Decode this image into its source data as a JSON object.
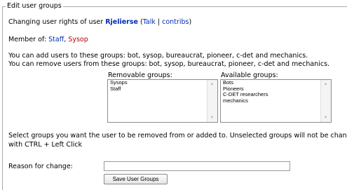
{
  "legend": "Edit user groups",
  "header": {
    "prefix": "Changing user rights of user ",
    "username": "Rjelierse",
    "open_paren": " (",
    "talk_link": "Talk",
    "separator": " | ",
    "contribs_link": "contribs",
    "close_paren": ")"
  },
  "membership": {
    "label": "Member of: ",
    "groups": [
      "Staff",
      "Sysop"
    ],
    "separator": ", "
  },
  "permissions": {
    "can_add": "You can add users to these groups: bot, sysop, bureaucrat, pioneer, c-det and mechanics.",
    "can_remove": "You can remove users from these groups: bot, sysop, bureaucrat, pioneer, c-det and mechanics."
  },
  "removable": {
    "label": "Removable groups:",
    "options": [
      "Sysops",
      "Staff"
    ]
  },
  "available": {
    "label": "Available groups:",
    "options": [
      "Bots",
      "Pioneers",
      "C-DET researchers",
      "mechanics"
    ]
  },
  "instructions": {
    "line1": "Select groups you want the user to be removed from or added to. Unselected groups will not be chan",
    "line2": "with CTRL + Left Click"
  },
  "reason": {
    "label": "Reason for change:",
    "value": ""
  },
  "submit": {
    "label": "Save User Groups"
  },
  "colors": {
    "link": "#002bb8",
    "new_link": "#ba0000"
  }
}
